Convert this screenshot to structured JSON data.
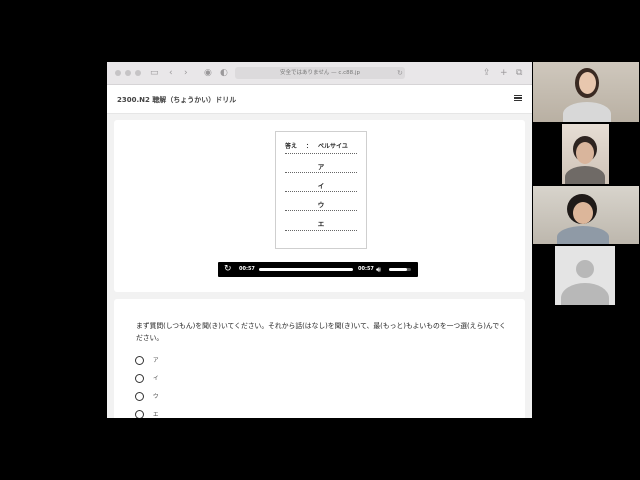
{
  "browser": {
    "url_text": "安全ではありません — c.c88.jp",
    "icons": [
      "sidebar-icon",
      "back-icon",
      "forward-icon",
      "shield-icon",
      "reader-icon",
      "reload-icon",
      "share-icon",
      "new-tab-icon",
      "tabs-icon"
    ]
  },
  "site": {
    "title": "2300.N2 聴解（ちょうかい）ドリル"
  },
  "answer_sheet": {
    "label": "答え",
    "colon": "：",
    "answer": "ベルサイユ",
    "options": [
      "ア",
      "イ",
      "ウ",
      "エ"
    ]
  },
  "player": {
    "current_time": "00:57",
    "duration": "00:57",
    "progress": 1.0,
    "volume": 0.8
  },
  "question": {
    "text": "まず質問(しつもん)を聞(き)いてください。それから話(はなし)を聞(き)いて、最(もっと)もよいものを一つ選(えら)んでください。",
    "choices": [
      "ア",
      "イ",
      "ウ",
      "エ"
    ]
  },
  "colors": {
    "accent": "#000000",
    "page_bg": "#f2f2f2"
  }
}
